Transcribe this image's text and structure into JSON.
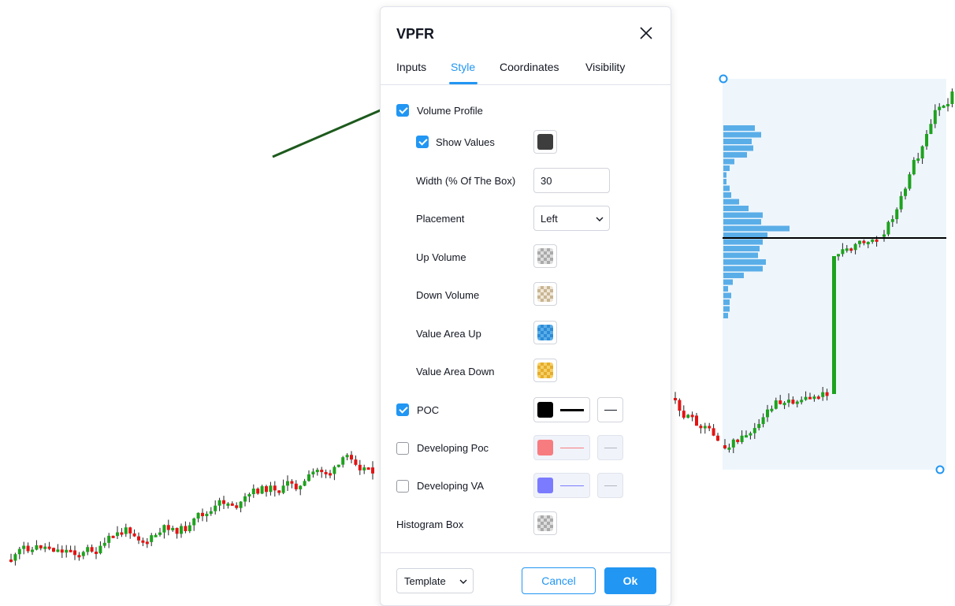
{
  "dialog": {
    "title": "VPFR",
    "tabs": [
      {
        "label": "Inputs",
        "active": false
      },
      {
        "label": "Style",
        "active": true
      },
      {
        "label": "Coordinates",
        "active": false
      },
      {
        "label": "Visibility",
        "active": false
      }
    ],
    "style": {
      "volume_profile": {
        "label": "Volume Profile",
        "checked": true
      },
      "show_values": {
        "label": "Show Values",
        "checked": true,
        "color": "#3d3d3d"
      },
      "width": {
        "label": "Width (% Of The Box)",
        "value": "30"
      },
      "placement": {
        "label": "Placement",
        "value": "Left"
      },
      "up_volume": {
        "label": "Up Volume",
        "color": "checker-grey"
      },
      "down_volume": {
        "label": "Down Volume",
        "color": "checker-tan"
      },
      "value_area_up": {
        "label": "Value Area Up",
        "color": "#2196f3"
      },
      "value_area_down": {
        "label": "Value Area Down",
        "color": "#f5b733"
      },
      "poc": {
        "label": "POC",
        "checked": true,
        "color": "#000000"
      },
      "developing_poc": {
        "label": "Developing Poc",
        "checked": false,
        "color": "#f77c80"
      },
      "developing_va": {
        "label": "Developing VA",
        "checked": false,
        "color": "#7b7bff"
      },
      "histogram_box": {
        "label": "Histogram Box",
        "color": "checker-grey"
      }
    },
    "footer": {
      "template_label": "Template",
      "cancel_label": "Cancel",
      "ok_label": "Ok"
    }
  },
  "colors": {
    "accent": "#2196f3",
    "candle_up": "#1ea21e",
    "candle_down": "#e31414",
    "profile_bar": "#5aaee8",
    "box_fill": "#eef6fc",
    "arrow": "#1d5a1d"
  },
  "icons": [
    "close-icon",
    "chevron-down-icon",
    "checkbox-check-icon",
    "arrow-annotation",
    "anchor-handle"
  ]
}
